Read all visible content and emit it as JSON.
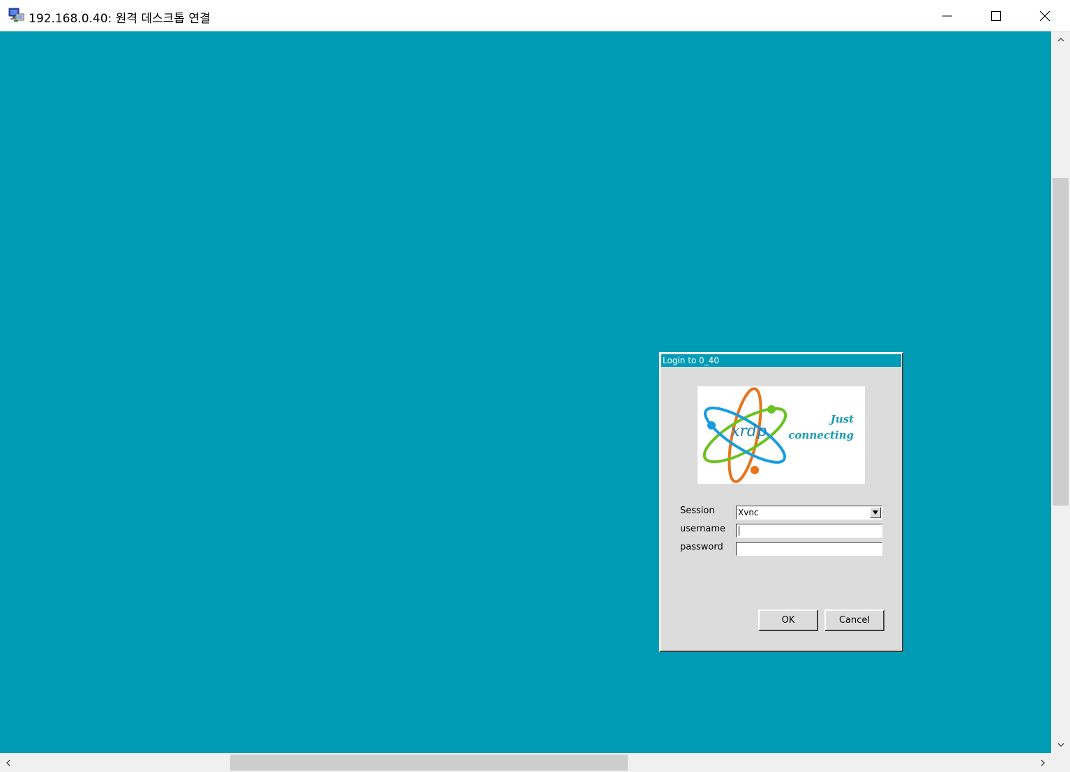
{
  "window": {
    "title": "192.168.0.40: 원격 데스크톱 연결",
    "icon": "remote-desktop-icon"
  },
  "dialog": {
    "title": "Login to 0_40",
    "logo": {
      "brand": "xrdp",
      "tagline_line1": "Just",
      "tagline_line2": "connecting"
    },
    "session_label": "Session",
    "session_value": "Xvnc",
    "username_label": "username",
    "username_value": "",
    "password_label": "password",
    "password_value": "",
    "ok_label": "OK",
    "cancel_label": "Cancel"
  },
  "colors": {
    "desktop_bg": "#009cb5",
    "dialog_bg": "#dcdcdc",
    "dialog_title_bg": "#009cb5"
  }
}
